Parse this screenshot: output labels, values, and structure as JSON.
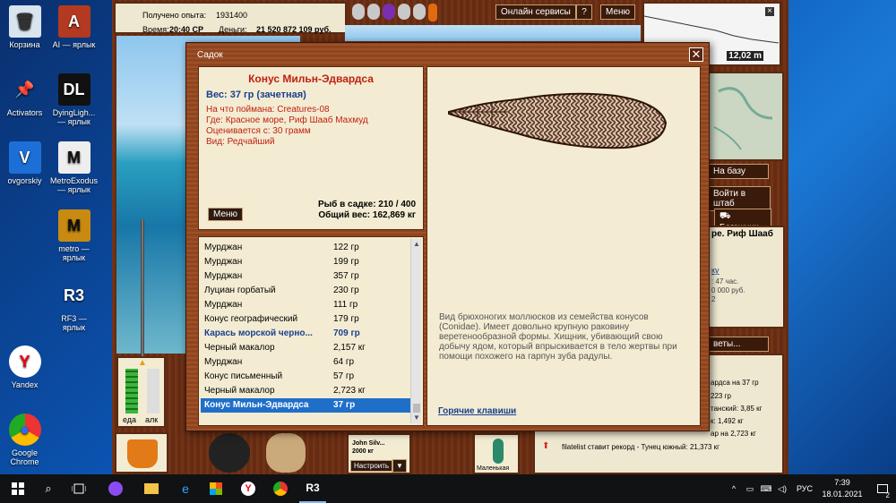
{
  "desktop": {
    "icons": [
      {
        "label": "Корзина",
        "glyph": "🗑"
      },
      {
        "label": "AI — ярлык",
        "glyph": "A"
      },
      {
        "label": "Activators",
        "glyph": "📌"
      },
      {
        "label": "DyingLigh... — ярлык",
        "glyph": "DL"
      },
      {
        "label": "ovgorskiy",
        "glyph": "V"
      },
      {
        "label": "MetroExodus — ярлык",
        "glyph": "M"
      },
      {
        "label": "metro — ярлык",
        "glyph": "M"
      },
      {
        "label": "RF3 — ярлык",
        "glyph": "R3"
      },
      {
        "label": "Yandex",
        "glyph": "Y"
      },
      {
        "label": "Google Chrome",
        "glyph": "●"
      }
    ]
  },
  "game": {
    "top": {
      "experience_label": "Получено опыта:",
      "experience_value": "1931400",
      "time_label": "Время:",
      "time_value": "20:40 СР",
      "money_label": "Деньги:",
      "money_value": "21 520 872 109 руб.",
      "online_services": "Онлайн сервисы",
      "help": "?",
      "menu": "Меню",
      "depth": "12,02 m"
    },
    "right_side": {
      "to_base": "На базу",
      "to_hq": "Войти в штаб",
      "trunk": "Багажник",
      "location_fragment": "ре. Риф Шааб",
      "link_fragment": "ку",
      "info_1": ": 47 час.",
      "info_2": "0 000 руб.",
      "info_3": "2",
      "events_button": "веты...",
      "feed_1": "ардса на 37 гр",
      "feed_2": "223 гр",
      "feed_3": "танский: 3,85 кг",
      "feed_4": "к: 1,492 кг",
      "feed_5": "ар на 2,723 кг",
      "feed_6": "filatelist ставит рекорд - Тунец южный: 21,373 кг"
    },
    "bottom": {
      "bait_name": "John Silv...",
      "bait_weight": "2000 кг",
      "configure": "Настроить",
      "small_label": "Маленькая",
      "food_label": "еда",
      "alc_label": "алк"
    }
  },
  "dialog": {
    "title": "Садок",
    "close": "✕",
    "fish": {
      "name": "Конус Мильн-Эдвардса",
      "weight": "Вес: 37 гр (зачетная)",
      "caught_on": "На что поймана: Creatures-08",
      "where": "Где: Красное море, Риф Шааб Махмуд",
      "valued_from": "Оценивается с: 30 грамм",
      "kind": "Вид: Редчайший"
    },
    "menu_button": "Меню",
    "stats": {
      "in_keepnet": "Рыб в садке: 210 / 400",
      "total_weight": "Общий вес: 162,869 кг"
    },
    "list": [
      {
        "name": "Мурджан",
        "weight": "122 гр"
      },
      {
        "name": "Мурджан",
        "weight": "199 гр"
      },
      {
        "name": "Мурджан",
        "weight": "357 гр"
      },
      {
        "name": "Луциан горбатый",
        "weight": "230 гр"
      },
      {
        "name": "Мурджан",
        "weight": "111 гр"
      },
      {
        "name": "Конус географический",
        "weight": "179 гр"
      },
      {
        "name": "Карась морской черно...",
        "weight": "709 гр"
      },
      {
        "name": "Черный макалор",
        "weight": "2,157 кг"
      },
      {
        "name": "Мурджан",
        "weight": "64 гр"
      },
      {
        "name": "Конус письменный",
        "weight": "57 гр"
      },
      {
        "name": "Черный макалор",
        "weight": "2,723 кг"
      },
      {
        "name": "Конус Мильн-Эдвардса",
        "weight": "37 гр"
      }
    ],
    "description": "Вид брюхоногих моллюсков из семейства конусов (Conidae). Имеет довольно крупную раковину веретенообразной формы. Хищник, убивающий свою добычу ядом, который впрыскивается в тело жертвы при помощи похожего на гарпун зуба радулы.",
    "hotkeys": "Горячие клавиши"
  },
  "taskbar": {
    "lang": "РУС",
    "time": "7:39",
    "date": "18.01.2021",
    "notifications_badge": "2"
  },
  "colors": {
    "wood": "#8a3e18",
    "panel": "#f3ecd2",
    "title_red": "#c02010",
    "accent_blue": "#1a3f8f",
    "selection": "#1f6fc9"
  }
}
